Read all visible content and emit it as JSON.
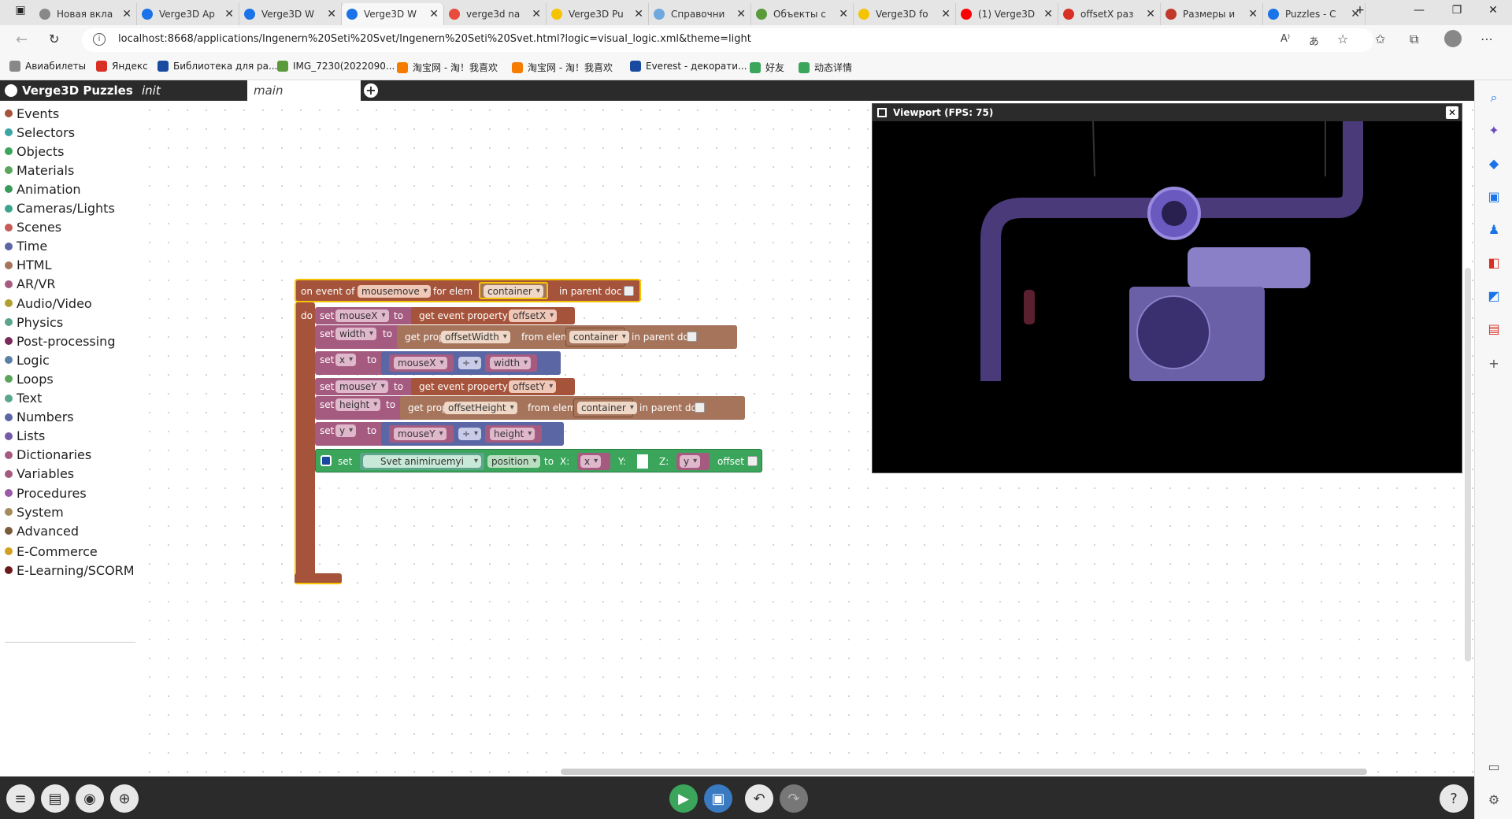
{
  "browser": {
    "tabs": [
      {
        "label": "Новая вкла",
        "color": "#888"
      },
      {
        "label": "Verge3D Ap",
        "color": "#1a73e8"
      },
      {
        "label": "Verge3D W",
        "color": "#1a73e8"
      },
      {
        "label": "Verge3D W",
        "color": "#1a73e8",
        "active": true
      },
      {
        "label": "verge3d na",
        "color": "#e74c3c"
      },
      {
        "label": "Verge3D Pu",
        "color": "#f5c400"
      },
      {
        "label": "Справочни",
        "color": "#6fa8dc"
      },
      {
        "label": "Объекты с",
        "color": "#5a9a3a"
      },
      {
        "label": "Verge3D fo",
        "color": "#f5c400"
      },
      {
        "label": "(1) Verge3D",
        "color": "#ff0000"
      },
      {
        "label": "offsetX раз",
        "color": "#d93025"
      },
      {
        "label": "Размеры и",
        "color": "#c0392b"
      },
      {
        "label": "Puzzles - C",
        "color": "#1a73e8"
      }
    ],
    "url": "localhost:8668/applications/Ingenern%20Seti%20Svet/Ingenern%20Seti%20Svet.html?logic=visual_logic.xml&theme=light",
    "bookmarks": [
      "Авиабилеты",
      "Яндекс",
      "Библиотека для ра...",
      "IMG_7230(2022090...",
      "淘宝网 - 淘！我喜欢",
      "淘宝网 - 淘！我喜欢",
      "Everest - декорати...",
      "好友",
      "动态详情"
    ]
  },
  "app": {
    "brand": "Verge3D Puzzles",
    "tabs": [
      "init",
      "main"
    ],
    "categories": [
      {
        "label": "Events",
        "color": "#a5533a"
      },
      {
        "label": "Selectors",
        "color": "#3aa5a5"
      },
      {
        "label": "Objects",
        "color": "#3aa55b"
      },
      {
        "label": "Materials",
        "color": "#5ba55b"
      },
      {
        "label": "Animation",
        "color": "#3a9a5b"
      },
      {
        "label": "Cameras/Lights",
        "color": "#3aa58a"
      },
      {
        "label": "Scenes",
        "color": "#c85a5a"
      },
      {
        "label": "Time",
        "color": "#5b67a5"
      },
      {
        "label": "HTML",
        "color": "#a5745b"
      },
      {
        "label": "AR/VR",
        "color": "#a55b80"
      },
      {
        "label": "Audio/Video",
        "color": "#b0a030"
      },
      {
        "label": "Physics",
        "color": "#5ba58a"
      },
      {
        "label": "Post-processing",
        "color": "#7a2a5a"
      },
      {
        "label": "Logic",
        "color": "#5b80a5"
      },
      {
        "label": "Loops",
        "color": "#5ba55b"
      },
      {
        "label": "Text",
        "color": "#5ba58a"
      },
      {
        "label": "Numbers",
        "color": "#5b67a5"
      },
      {
        "label": "Lists",
        "color": "#745ba5"
      },
      {
        "label": "Dictionaries",
        "color": "#a55b80"
      },
      {
        "label": "Variables",
        "color": "#a55b80"
      },
      {
        "label": "Procedures",
        "color": "#995ba5"
      },
      {
        "label": "System",
        "color": "#a58a5b"
      },
      {
        "label": "Advanced",
        "color": "#7a5b3a"
      },
      {
        "label": "E-Commerce",
        "color": "#d0a020"
      },
      {
        "label": "E-Learning/SCORM",
        "color": "#6a1a1a"
      }
    ],
    "viewport_title": "Viewport (FPS: 75)"
  },
  "blocks": {
    "event": {
      "prefix": "on event of",
      "event": "mousemove",
      "for_elem": "for elem",
      "elem": "container",
      "in_parent": "in parent doc",
      "do": "do"
    },
    "set": "set",
    "to": "to",
    "get_event_property": "get event property",
    "get_prop": "get prop",
    "from_elem": "from elem",
    "in_parent": "in parent doc",
    "rows": {
      "r1": {
        "var": "mouseX",
        "prop": "offsetX"
      },
      "r2": {
        "var": "width",
        "prop": "offsetWidth",
        "elem": "container"
      },
      "r3": {
        "var": "x",
        "a": "mouseX",
        "op": "÷",
        "b": "width"
      },
      "r4": {
        "var": "mouseY",
        "prop": "offsetY"
      },
      "r5": {
        "var": "height",
        "prop": "offsetHeight",
        "elem": "container"
      },
      "r6": {
        "var": "y",
        "a": "mouseY",
        "op": "÷",
        "b": "height"
      }
    },
    "transform": {
      "set": "set",
      "obj": "Svet animiruemyi",
      "param": "position",
      "to": "to",
      "xl": "X:",
      "xv": "x",
      "yl": "Y:",
      "zl": "Z:",
      "zv": "y",
      "offset": "offset"
    }
  },
  "icons": {
    "add_tab": "+",
    "undo": "↶",
    "redo": "↷",
    "help": "?",
    "play": "▶"
  }
}
